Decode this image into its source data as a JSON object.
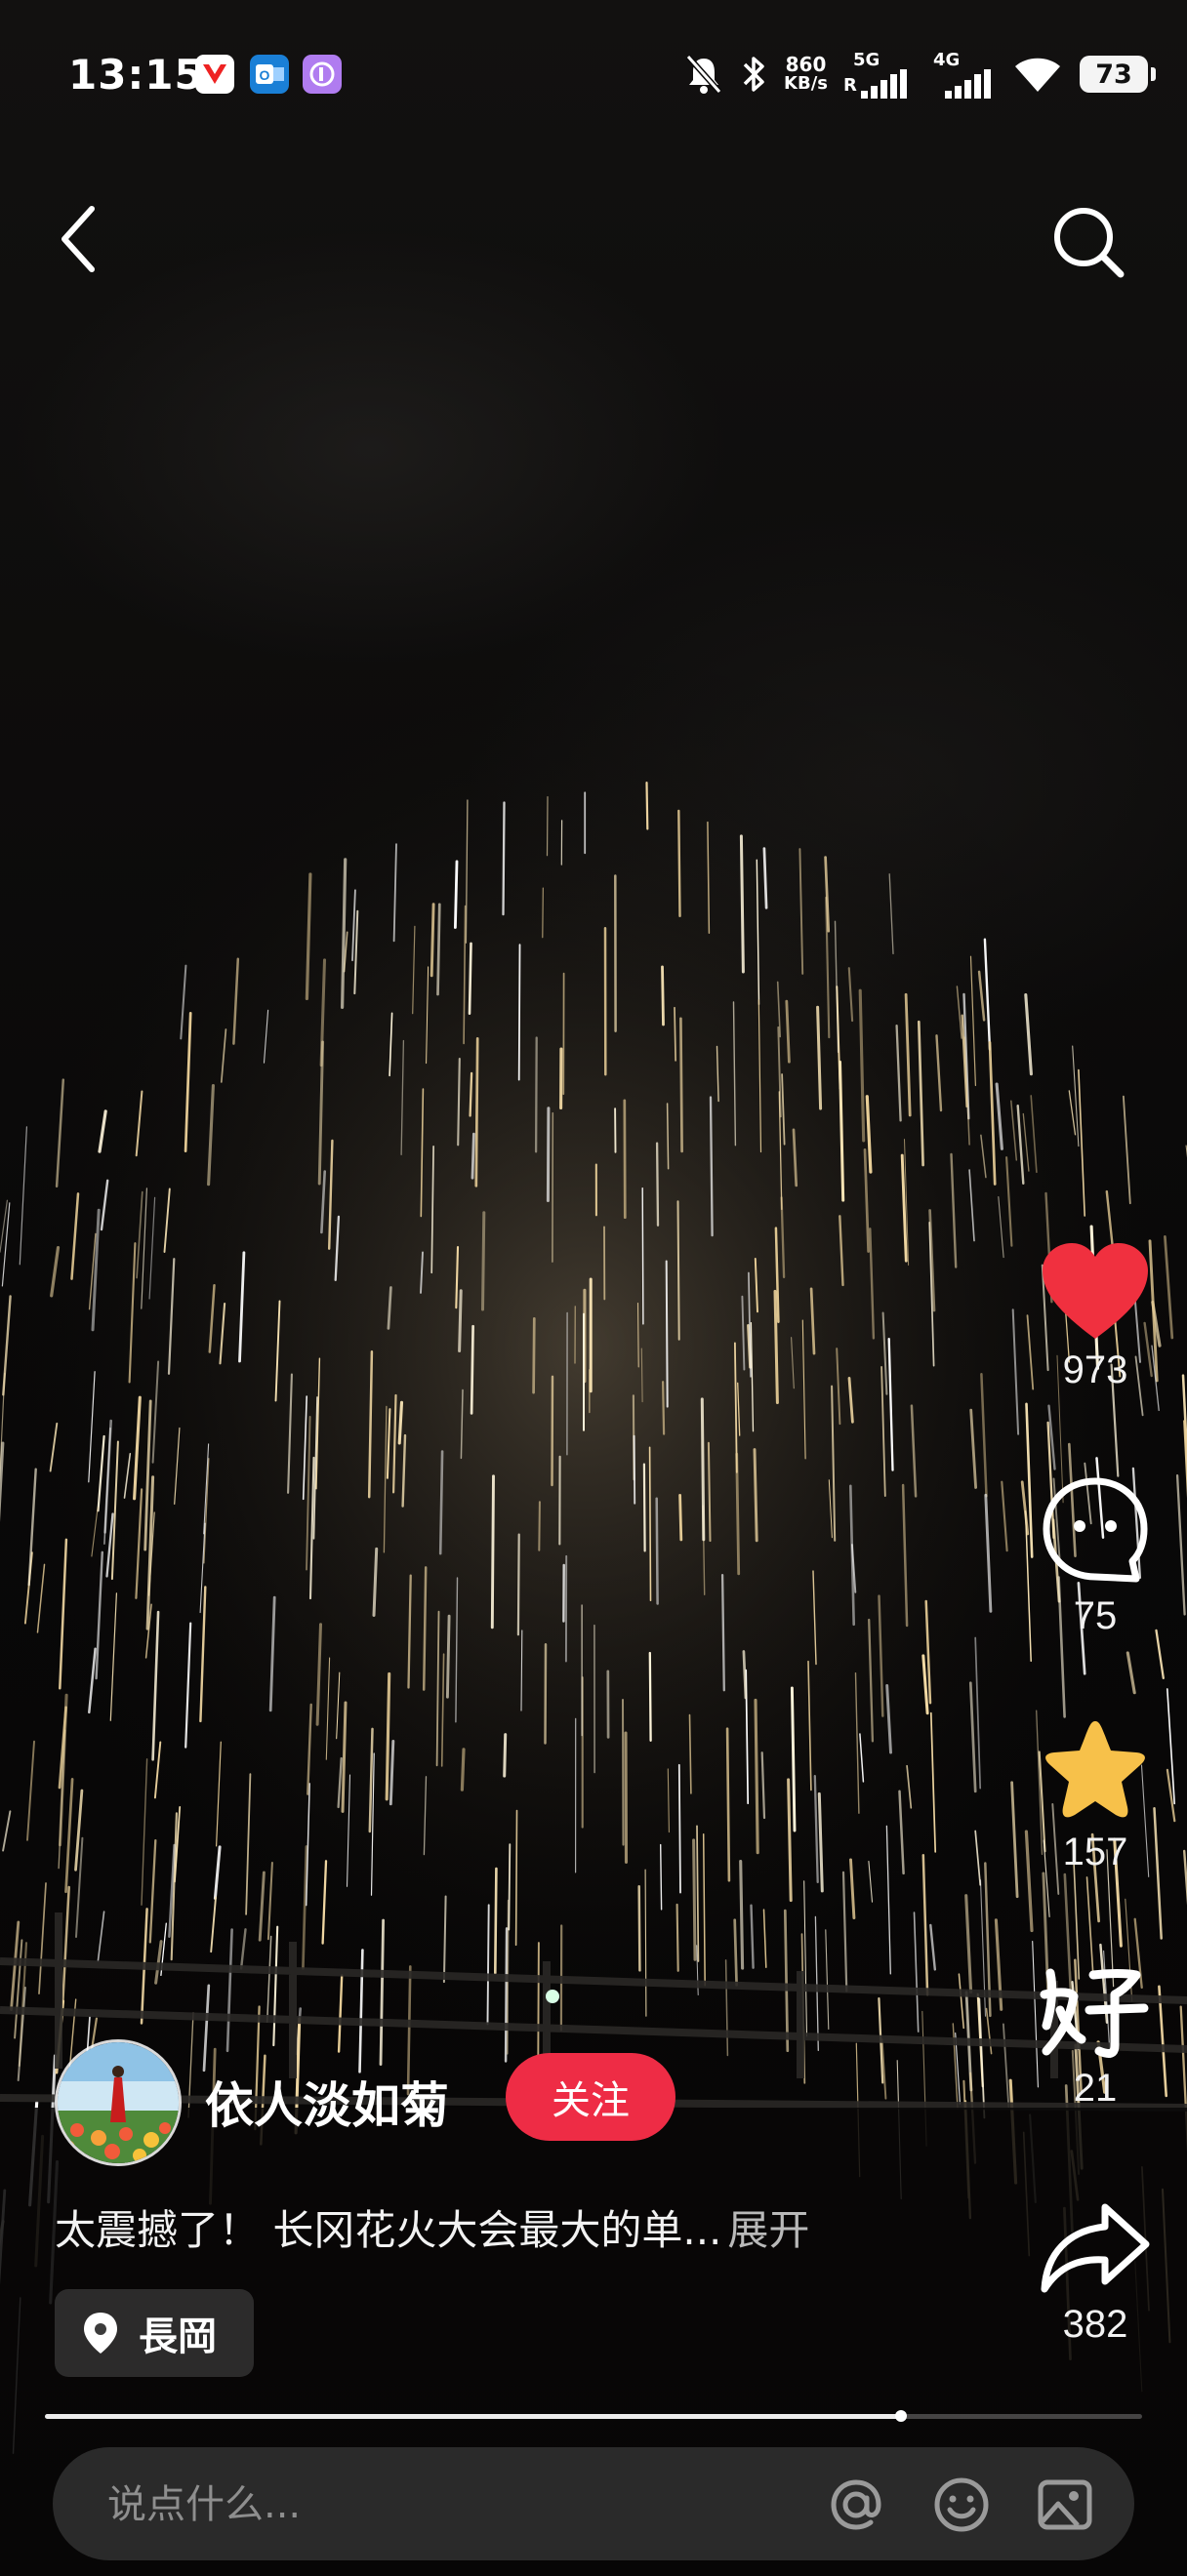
{
  "status_bar": {
    "time": "13:15",
    "net_speed_value": "860",
    "net_speed_unit": "KB/s",
    "sim1_label": "5G",
    "sim1_sub": "R",
    "sim2_label": "4G",
    "battery": "73"
  },
  "post": {
    "author": "依人淡如菊",
    "follow_label": "关注",
    "caption": "太震撼了！ 长冈花火大会最大的单...",
    "expand_label": "展开",
    "location": "長岡",
    "progress_fraction": 0.78
  },
  "actions": {
    "likes": "973",
    "comments": "75",
    "favorites": "157",
    "good": "21",
    "shares": "382"
  },
  "comment_bar": {
    "placeholder": "说点什么..."
  },
  "colors": {
    "like": "#f0303f",
    "favorite": "#f7c14a",
    "follow": "#ee2c45"
  }
}
